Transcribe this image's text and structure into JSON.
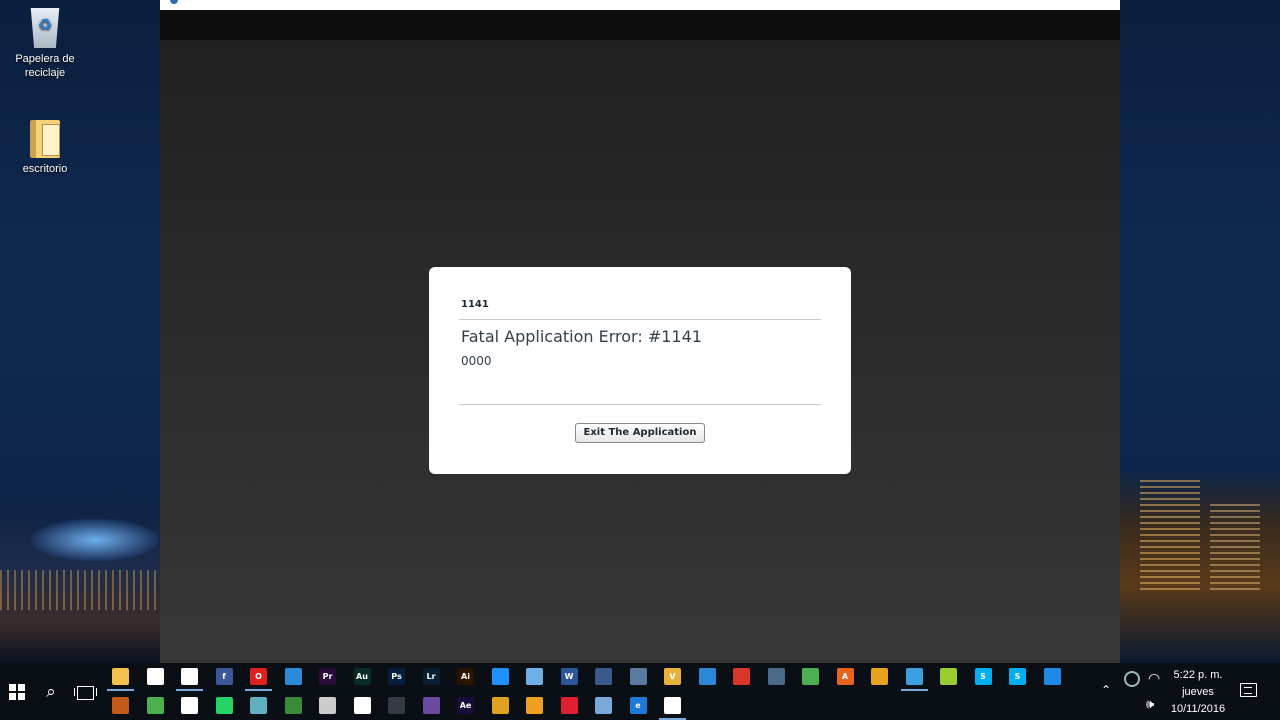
{
  "desktop": {
    "icons": [
      {
        "label": "Papelera de reciclaje"
      },
      {
        "label": "escritorio"
      }
    ]
  },
  "dialog": {
    "code": "1141",
    "title": "Fatal Application Error: #1141",
    "detail": "0000",
    "exit_label": "Exit The Application"
  },
  "taskbar": {
    "row1": [
      {
        "name": "file-explorer-icon",
        "color": "#f2c14e",
        "glyph": "",
        "active": true
      },
      {
        "name": "store-icon",
        "color": "#ffffff",
        "glyph": "",
        "active": false
      },
      {
        "name": "groove-music-icon",
        "color": "#ffffff",
        "glyph": "",
        "active": true
      },
      {
        "name": "facebook-icon",
        "color": "#3b5998",
        "glyph": "f",
        "active": false
      },
      {
        "name": "opera-icon",
        "color": "#e0201f",
        "glyph": "O",
        "active": true
      },
      {
        "name": "app-blue-icon",
        "color": "#2b8bd8",
        "glyph": "",
        "active": false
      },
      {
        "name": "premiere-icon",
        "color": "#2a0b3a",
        "glyph": "Pr",
        "active": false
      },
      {
        "name": "audition-icon",
        "color": "#0a2c26",
        "glyph": "Au",
        "active": false
      },
      {
        "name": "photoshop-icon",
        "color": "#061e3a",
        "glyph": "Ps",
        "active": false
      },
      {
        "name": "lightroom-icon",
        "color": "#0b1f33",
        "glyph": "Lr",
        "active": false
      },
      {
        "name": "illustrator-icon",
        "color": "#2c1500",
        "glyph": "Ai",
        "active": false
      },
      {
        "name": "app-cyan-icon",
        "color": "#1e90ff",
        "glyph": "",
        "active": false
      },
      {
        "name": "image-viewer-icon",
        "color": "#6fb1e6",
        "glyph": "",
        "active": false
      },
      {
        "name": "word-icon",
        "color": "#2b579a",
        "glyph": "W",
        "active": false
      },
      {
        "name": "app-globe-icon",
        "color": "#3a5a8a",
        "glyph": "",
        "active": false
      },
      {
        "name": "app-network-icon",
        "color": "#5a7aa0",
        "glyph": "",
        "active": false
      },
      {
        "name": "vectorize-icon",
        "color": "#e8b23a",
        "glyph": "V",
        "active": false
      },
      {
        "name": "app-doc-icon",
        "color": "#2b88d8",
        "glyph": "",
        "active": false
      },
      {
        "name": "app-red-icon",
        "color": "#d9362b",
        "glyph": "",
        "active": false
      },
      {
        "name": "app-circle-icon",
        "color": "#4a6a8a",
        "glyph": "",
        "active": false
      },
      {
        "name": "app-green-arrow-icon",
        "color": "#4caf50",
        "glyph": "",
        "active": false
      },
      {
        "name": "app-a-icon",
        "color": "#e8641e",
        "glyph": "A",
        "active": false
      },
      {
        "name": "app-yellow-icon",
        "color": "#e8a41e",
        "glyph": "",
        "active": false
      },
      {
        "name": "app-wave-icon",
        "color": "#3aa0e0",
        "glyph": "",
        "active": true
      },
      {
        "name": "app-lime-icon",
        "color": "#9acd32",
        "glyph": "",
        "active": false
      },
      {
        "name": "skype-icon",
        "color": "#00aff0",
        "glyph": "S",
        "active": false
      },
      {
        "name": "skype-alt-icon",
        "color": "#00aff0",
        "glyph": "S",
        "active": false
      },
      {
        "name": "messenger-icon",
        "color": "#1e88e5",
        "glyph": "",
        "active": false
      }
    ],
    "row2": [
      {
        "name": "app-orange-icon",
        "color": "#c45a1a",
        "glyph": "",
        "active": false
      },
      {
        "name": "app-green-icon",
        "color": "#4caf50",
        "glyph": "",
        "active": false
      },
      {
        "name": "app-pen-icon",
        "color": "#ffffff",
        "glyph": "",
        "active": false
      },
      {
        "name": "whatsapp-icon",
        "color": "#25d366",
        "glyph": "",
        "active": false
      },
      {
        "name": "app-shield-icon",
        "color": "#5fb0c0",
        "glyph": "",
        "active": false
      },
      {
        "name": "excel-like-icon",
        "color": "#3a8a3a",
        "glyph": "",
        "active": false
      },
      {
        "name": "microphone-icon",
        "color": "#cccccc",
        "glyph": "",
        "active": false
      },
      {
        "name": "calculator-icon",
        "color": "#ffffff",
        "glyph": "",
        "active": false
      },
      {
        "name": "app-nox-icon",
        "color": "#333b44",
        "glyph": "",
        "active": false
      },
      {
        "name": "app-purple-icon",
        "color": "#6a4aa0",
        "glyph": "",
        "active": false
      },
      {
        "name": "after-effects-icon",
        "color": "#1a0b3a",
        "glyph": "Ae",
        "active": false
      },
      {
        "name": "chrome-icon",
        "color": "#e0a020",
        "glyph": "",
        "active": false
      },
      {
        "name": "app-bolt-icon",
        "color": "#f0a020",
        "glyph": "",
        "active": false
      },
      {
        "name": "app-target-icon",
        "color": "#e02030",
        "glyph": "",
        "active": false
      },
      {
        "name": "remote-desktop-icon",
        "color": "#7aa8d8",
        "glyph": "",
        "active": false
      },
      {
        "name": "edge-icon",
        "color": "#1e78d8",
        "glyph": "e",
        "active": false
      },
      {
        "name": "settings-icon",
        "color": "#ffffff",
        "glyph": "",
        "active": true
      }
    ],
    "clock": {
      "time": "5:22 p. m.",
      "day": "jueves",
      "date": "10/11/2016"
    }
  }
}
